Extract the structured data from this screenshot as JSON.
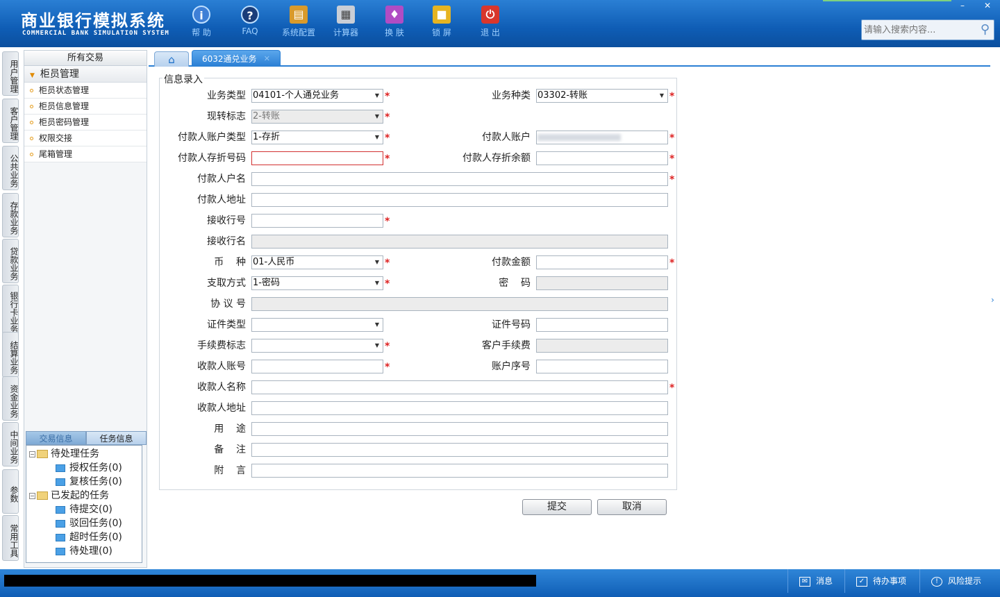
{
  "app": {
    "title_cn": "商业银行模拟系统",
    "title_en": "COMMERCIAL BANK SIMULATION SYSTEM"
  },
  "toolbar": [
    {
      "label": "帮 助",
      "icon": "help-icon"
    },
    {
      "label": "FAQ",
      "icon": "faq-icon"
    },
    {
      "label": "系统配置",
      "icon": "toolbox-icon"
    },
    {
      "label": "计算器",
      "icon": "calculator-icon"
    },
    {
      "label": "换 肤",
      "icon": "shirt-icon"
    },
    {
      "label": "锁 屏",
      "icon": "lock-icon"
    },
    {
      "label": "退 出",
      "icon": "power-icon"
    }
  ],
  "window": {
    "minimize": "–",
    "close": "✕"
  },
  "search": {
    "placeholder": "请输入搜索内容..."
  },
  "side_tabs": [
    "用户管理",
    "客户管理",
    "公共业务",
    "存款业务",
    "贷款业务",
    "银行卡业务",
    "结算业务",
    "资金业务",
    "中间业务",
    "参数",
    "常用工具"
  ],
  "left_panel": {
    "header": "所有交易",
    "group": "柜员管理",
    "items": [
      "柜员状态管理",
      "柜员信息管理",
      "柜员密码管理",
      "权限交接",
      "尾箱管理"
    ],
    "tabs": [
      "交易信息",
      "任务信息"
    ],
    "tree": {
      "pending": "待处理任务",
      "pending_children": [
        "授权任务(0)",
        "复核任务(0)"
      ],
      "initiated": "已发起的任务",
      "initiated_children": [
        "待提交(0)",
        "驳回任务(0)",
        "超时任务(0)",
        "待处理(0)"
      ]
    }
  },
  "tabs": {
    "home_icon": "home-icon",
    "active": "6032通兑业务",
    "close": "✕"
  },
  "form": {
    "legend": "信息录入",
    "labels": {
      "biz_type": "业务类型",
      "biz_kind": "业务种类",
      "cash_flag": "现转标志",
      "payer_acct_type": "付款人账户类型",
      "payer_acct": "付款人账户",
      "payer_book_no": "付款人存折号码",
      "payer_book_balance": "付款人存折余额",
      "payer_name": "付款人户名",
      "payer_addr": "付款人地址",
      "recv_bank_no": "接收行号",
      "recv_bank_name": "接收行名",
      "currency": "币    种",
      "pay_amount": "付款金额",
      "withdraw_method": "支取方式",
      "password": "密    码",
      "agreement_no": "协 议 号",
      "id_type": "证件类型",
      "id_no": "证件号码",
      "fee_flag": "手续费标志",
      "cust_fee": "客户手续费",
      "payee_acct": "收款人账号",
      "acct_seq": "账户序号",
      "payee_name": "收款人名称",
      "payee_addr": "收款人地址",
      "purpose": "用    途",
      "remark": "备    注",
      "postscript": "附    言"
    },
    "values": {
      "biz_type": "04101-个人通兑业务",
      "biz_kind": "03302-转账",
      "cash_flag": "2-转账",
      "payer_acct_type": "1-存折",
      "currency": "01-人民币",
      "withdraw_method": "1-密码"
    },
    "required_mark": "*"
  },
  "buttons": {
    "submit": "提交",
    "cancel": "取消"
  },
  "status": {
    "message": "消息",
    "todo": "待办事项",
    "risk": "风险提示"
  }
}
